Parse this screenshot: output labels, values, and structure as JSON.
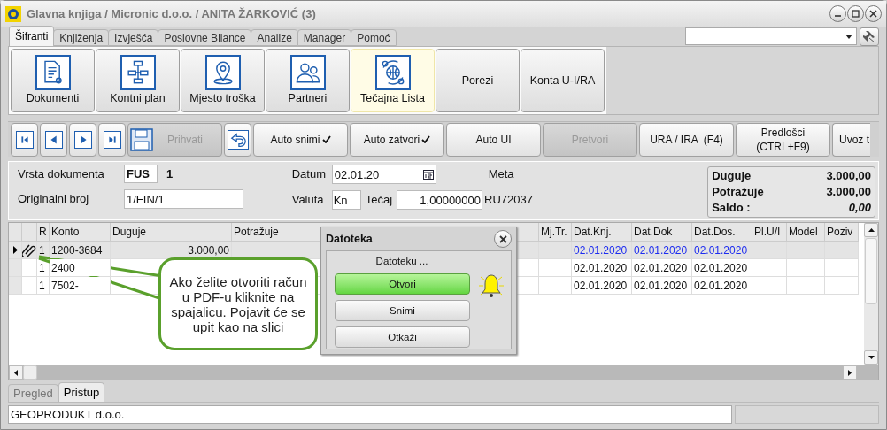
{
  "window": {
    "title": "Glavna knjiga / Micronic d.o.o. / ANITA ŽARKOVIĆ (3)"
  },
  "tabs": [
    {
      "label": "Šifranti",
      "selected": true
    },
    {
      "label": "Knjiženja",
      "selected": false
    },
    {
      "label": "Izvješća",
      "selected": false
    },
    {
      "label": "Poslovne Bilance",
      "selected": false
    },
    {
      "label": "Analize",
      "selected": false
    },
    {
      "label": "Manager",
      "selected": false
    },
    {
      "label": "Pomoć",
      "selected": false
    }
  ],
  "ribbon": [
    {
      "label": "Dokumenti",
      "kind": "icon",
      "selected": false
    },
    {
      "label": "Kontni plan",
      "kind": "icon",
      "selected": false
    },
    {
      "label": "Mjesto troška",
      "kind": "icon",
      "selected": false
    },
    {
      "label": "Partneri",
      "kind": "icon",
      "selected": false
    },
    {
      "label": "Tečajna Lista",
      "kind": "icon",
      "selected": true
    },
    {
      "label": "Porezi",
      "kind": "plain",
      "selected": false
    },
    {
      "label": "Konta U-I/RA",
      "kind": "plain",
      "selected": false
    }
  ],
  "nav_toolbar": [
    {
      "kind": "icon",
      "disabled": false
    },
    {
      "kind": "icon",
      "disabled": false
    },
    {
      "kind": "icon",
      "disabled": false
    },
    {
      "kind": "icon",
      "disabled": false
    },
    {
      "kind": "save",
      "label": "Prihvati",
      "disabled": true
    },
    {
      "kind": "icon",
      "disabled": false
    },
    {
      "kind": "text",
      "label": "Auto snimi",
      "checked": true,
      "disabled": false
    },
    {
      "kind": "text",
      "label": "Auto zatvori",
      "checked": true,
      "disabled": false
    },
    {
      "kind": "text",
      "label": "Auto UI",
      "checked": false,
      "disabled": false
    },
    {
      "kind": "text",
      "label": "Pretvori",
      "checked": false,
      "disabled": true
    },
    {
      "kind": "text",
      "label": "URA / IRA  (F4)",
      "checked": false,
      "disabled": false
    },
    {
      "kind": "text",
      "label": "Predlošci\n(CTRL+F9)",
      "checked": false,
      "disabled": false
    },
    {
      "kind": "text",
      "label": "Uvoz t",
      "disabled": false
    }
  ],
  "form": {
    "vrsta_label": "Vrsta dokumenta",
    "vrsta_value": "FUS",
    "vrsta_number": "1",
    "original_label": "Originalni broj",
    "original_value": "1/FIN/1",
    "datum_label": "Datum",
    "datum_value": "02.01.20",
    "meta_label": "Meta",
    "valuta_label": "Valuta",
    "valuta_value": "Kn",
    "tecaj_label": "Tečaj",
    "tecaj_value": "1,00000000",
    "code": "RU72037"
  },
  "totals": [
    {
      "label": "Duguje",
      "value": "3.000,00"
    },
    {
      "label": "Potražuje",
      "value": "3.000,00"
    },
    {
      "label": "Saldo  :",
      "value": "0,00"
    }
  ],
  "table": {
    "columns": [
      "R",
      "Konto",
      "Duguje",
      "Potražuje",
      "Mj.Tr.",
      "Dat.Knj.",
      "Dat.Dok",
      "Dat.Dos.",
      "Pl.U/I",
      "Model",
      "Poziv"
    ],
    "rows": [
      {
        "selected": true,
        "attachment": true,
        "r": "1",
        "konto": "1200-3684",
        "duguje": "3.000,00",
        "dat_knj": "02.01.2020",
        "dat_dok": "02.01.2020",
        "dat_dos": "02.01.2020"
      },
      {
        "selected": false,
        "attachment": false,
        "r": "1",
        "konto": "2400",
        "dat_knj": "02.01.2020",
        "dat_dok": "02.01.2020",
        "dat_dos": "02.01.2020"
      },
      {
        "selected": false,
        "attachment": false,
        "r": "1",
        "konto": "7502-",
        "dat_knj": "02.01.2020",
        "dat_dok": "02.01.2020",
        "dat_dos": "02.01.2020"
      }
    ]
  },
  "callout": {
    "text": "Ako želite otvoriti račun u PDF-u kliknite na spajalicu. Pojavit će se upit kao na slici"
  },
  "dialog": {
    "title": "Datoteka",
    "prompt": "Datoteku ...",
    "buttons": [
      {
        "label": "Otvori",
        "selected": true
      },
      {
        "label": "Snimi",
        "selected": false
      },
      {
        "label": "Otkaži",
        "selected": false
      }
    ]
  },
  "bottom_tabs": [
    {
      "label": "Pregled",
      "selected": false
    },
    {
      "label": "Pristup",
      "selected": true
    }
  ],
  "status_bar": {
    "company": "GEOPRODUKT d.o.o."
  }
}
